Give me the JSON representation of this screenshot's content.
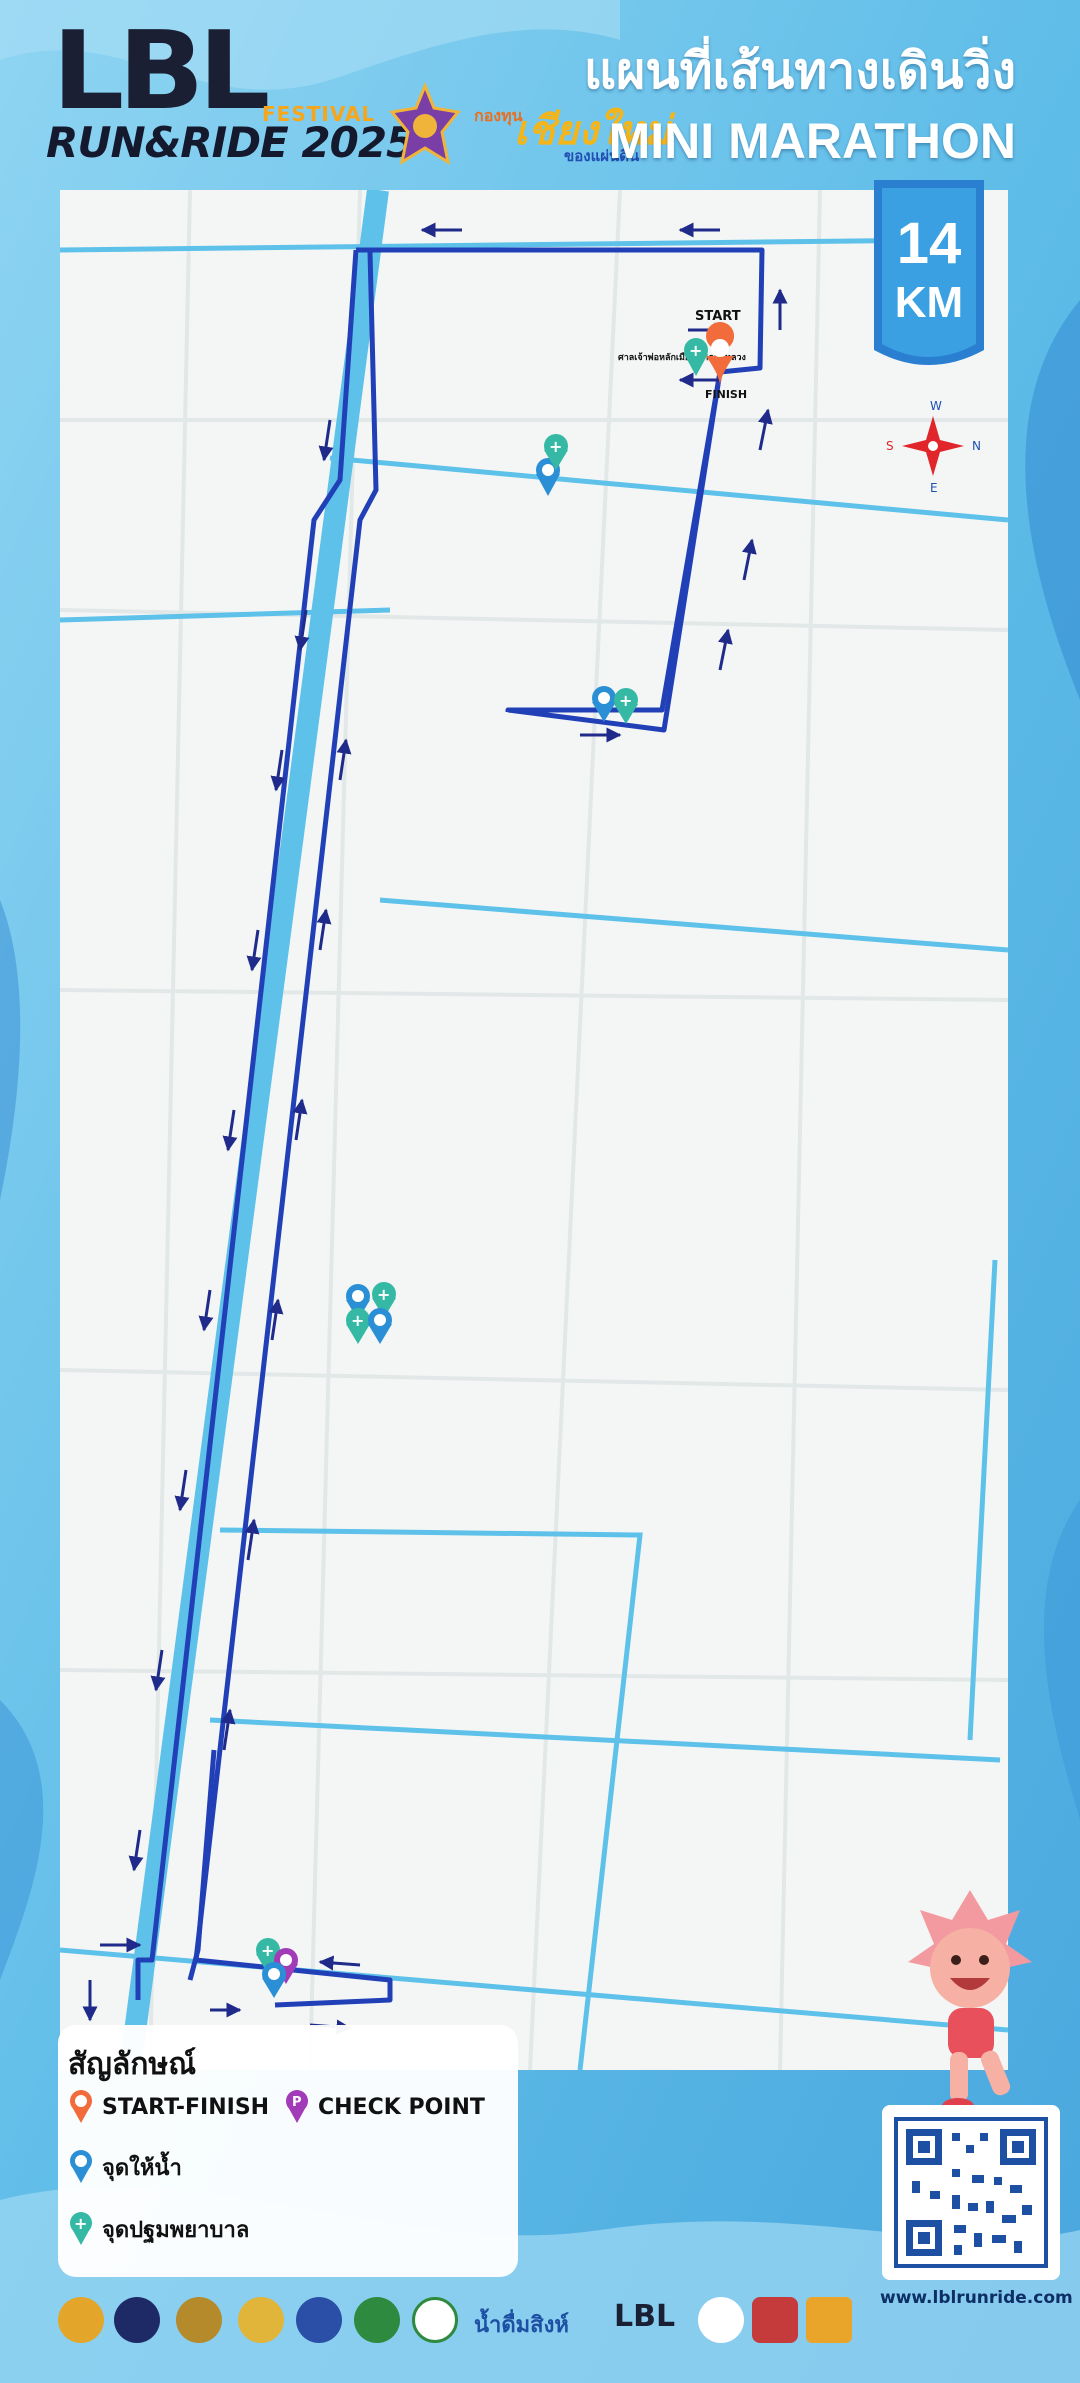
{
  "header": {
    "brand": "LBL",
    "brand_sub": "RUN&RIDE 2025",
    "festival": "FESTIVAL",
    "partner": "เชียงใหม่",
    "partner_prefix": "กองทุน",
    "partner_suffix": "ของแผ่นดิน",
    "title_th": "แผนที่เส้นทางเดินวิ่ง",
    "title_en": "MINI MARATHON"
  },
  "distance": {
    "value": "14",
    "unit": "KM"
  },
  "compass": {
    "north": "N",
    "south": "S",
    "east": "E",
    "west": "W"
  },
  "route_labels": {
    "start": "START",
    "finish": "FINISH",
    "start_place": "ศาลเจ้าพ่อหลักเมือง ลาดบัวหลวง"
  },
  "legend": {
    "title": "สัญลักษณ์",
    "items": [
      {
        "label": "START-FINISH",
        "icon": "start-finish-pin",
        "color": "#f26b3a"
      },
      {
        "label": "CHECK POINT",
        "icon": "check-point-pin",
        "color": "#a23bb8"
      },
      {
        "label": "จุดให้น้ำ",
        "icon": "water-station-pin",
        "color": "#2b8fd6"
      },
      {
        "label": "จุดปฐมพยาบาล",
        "icon": "first-aid-pin",
        "color": "#35b9a5"
      }
    ]
  },
  "footer": {
    "url": "www.lblrunride.com",
    "sponsor_text_1": "น้ำดื่มสิงห์",
    "sponsor_text_2": "LBL"
  },
  "colors": {
    "route": "#1f3fb5",
    "road": "#5ec1ea",
    "river": "#57b8e8",
    "accent": "#f26b3a"
  }
}
